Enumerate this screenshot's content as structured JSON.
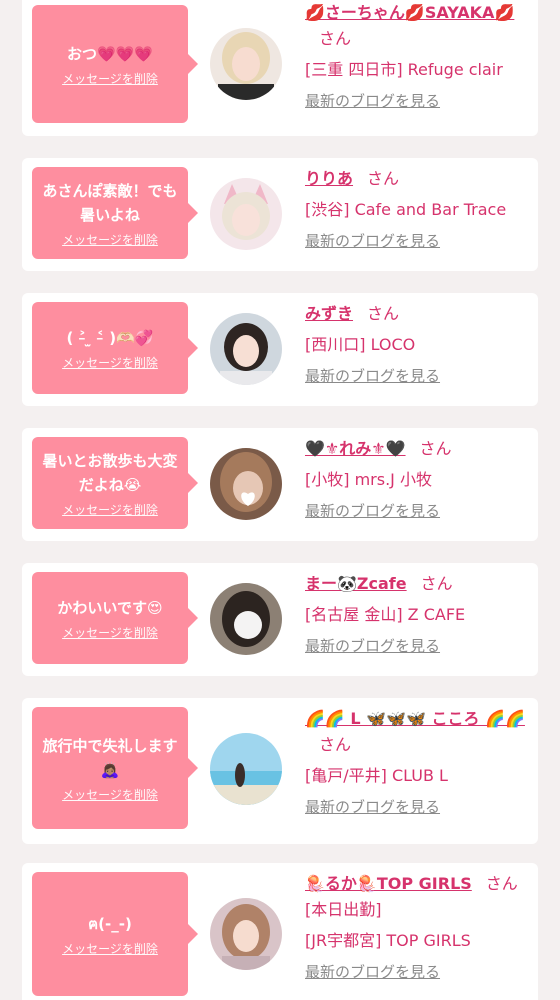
{
  "delete_label": "メッセージを削除",
  "san_label": "さん",
  "blog_label": "最新のブログを見る",
  "colors": {
    "accent": "#d6336c",
    "bubble": "#fe8e9f",
    "background": "#f4f0f0"
  },
  "cards": [
    {
      "message": "おつ💗💗💗",
      "name": "💋さーちゃん💋SAYAKA💋",
      "extra": "",
      "shop": "[三重 四日市] Refuge clair",
      "avatar": "avatar-blonde-selfie"
    },
    {
      "message": "あさんぽ素敵！でも暑いよね",
      "name": "りりあ",
      "extra": "",
      "shop": "[渋谷] Cafe and Bar Trace",
      "avatar": "avatar-cat-ears"
    },
    {
      "message": "( ˃̵ ̫ ˂̵ )🫶🏻💞",
      "name": "みずき",
      "extra": "",
      "shop": "[西川口] LOCO",
      "avatar": "avatar-dark-hair"
    },
    {
      "message": "暑いとお散歩も大変だよね😭",
      "name": "🖤⚜れみ⚜🖤",
      "extra": "",
      "shop": "[小牧] mrs.J 小牧",
      "avatar": "avatar-blurred"
    },
    {
      "message": "かわいいです😍",
      "name": "まー🐼Zcafe",
      "extra": "",
      "shop": "[名古屋 金山] Z CAFE",
      "avatar": "avatar-blurred-dark"
    },
    {
      "message": "旅行中で失礼します🙇🏽‍♀️",
      "name": "🌈🌈 L 🦋🦋🦋 こころ 🌈🌈",
      "extra": "",
      "shop": "[亀戸/平井] CLUB L",
      "avatar": "avatar-beach"
    },
    {
      "message": "ฅ(-_-)",
      "name": "🪼るか🪼TOP GIRLS",
      "extra": "[本日出勤]",
      "shop": "[JR宇都宮] TOP GIRLS",
      "avatar": "avatar-pink-room"
    }
  ]
}
